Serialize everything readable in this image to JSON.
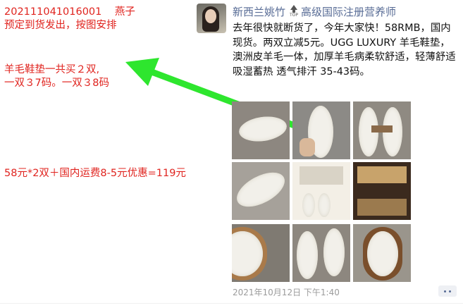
{
  "notes": {
    "order_id": "202111041016001    燕子",
    "order_status": "预定到货发出，按图安排",
    "qty_line1": "羊毛鞋垫一共买２双,",
    "qty_line2": "一双３7码。一双３8码",
    "price_line": "58元*2双＋国内运费8-5元优惠=119元"
  },
  "post": {
    "author": "新西兰姚竹",
    "badge": "TOP",
    "title": "高级国际注册营养师",
    "text": "去年很快就断货了，今年大家快！58RMB，国内现货。两双立减5元。UGG LUXURY 羊毛鞋垫，澳洲皮羊毛一体，加厚羊毛病柔软舒适，轻薄舒适 吸湿蓄热 透气排汗 35-43码。",
    "time": "2021年10月12日 下午1:40",
    "photo_count": 9
  },
  "colors": {
    "note_red": "#e0241f",
    "link_blue": "#576b95",
    "arrow_green": "#2ee62e"
  },
  "icons": [
    "arrow-icon",
    "top-arrow-icon",
    "more-dots-icon"
  ]
}
